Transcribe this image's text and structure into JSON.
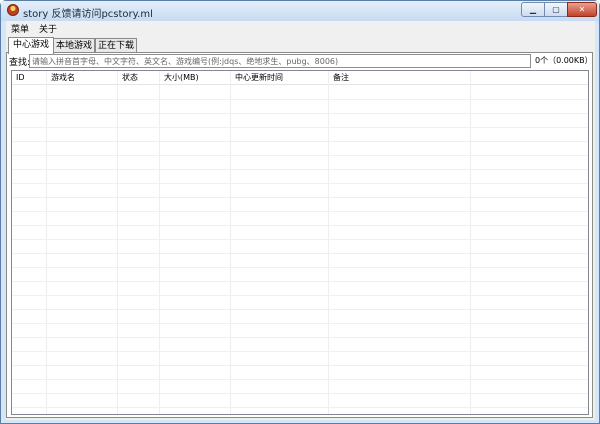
{
  "window": {
    "title": "story 反馈请访问pcstory.ml",
    "buttons": {
      "minimize": "▁",
      "maximize": "▢",
      "close": "✕"
    }
  },
  "menubar": {
    "items": [
      {
        "label": "菜单"
      },
      {
        "label": "关于"
      }
    ]
  },
  "tabs": [
    {
      "label": "中心游戏",
      "active": true
    },
    {
      "label": "本地游戏",
      "active": false
    },
    {
      "label": "正在下载",
      "active": false
    }
  ],
  "search": {
    "label": "查找:",
    "value": "",
    "placeholder": "请输入拼音首字母、中文字符、英文名、游戏编号(例:jdqs、绝地求生、pubg、8006)"
  },
  "summary": {
    "count_text": "0个（0.00KB）"
  },
  "table": {
    "columns": [
      {
        "label": "ID"
      },
      {
        "label": "游戏名"
      },
      {
        "label": "状态"
      },
      {
        "label": "大小(MB)"
      },
      {
        "label": "中心更新时间"
      },
      {
        "label": "备注"
      }
    ],
    "rows": []
  },
  "icons": {
    "app": "app-logo-icon"
  },
  "colors": {
    "title_bar": "#c8dbf2",
    "close_button": "#c4412a",
    "panel": "#f0f0f0"
  }
}
